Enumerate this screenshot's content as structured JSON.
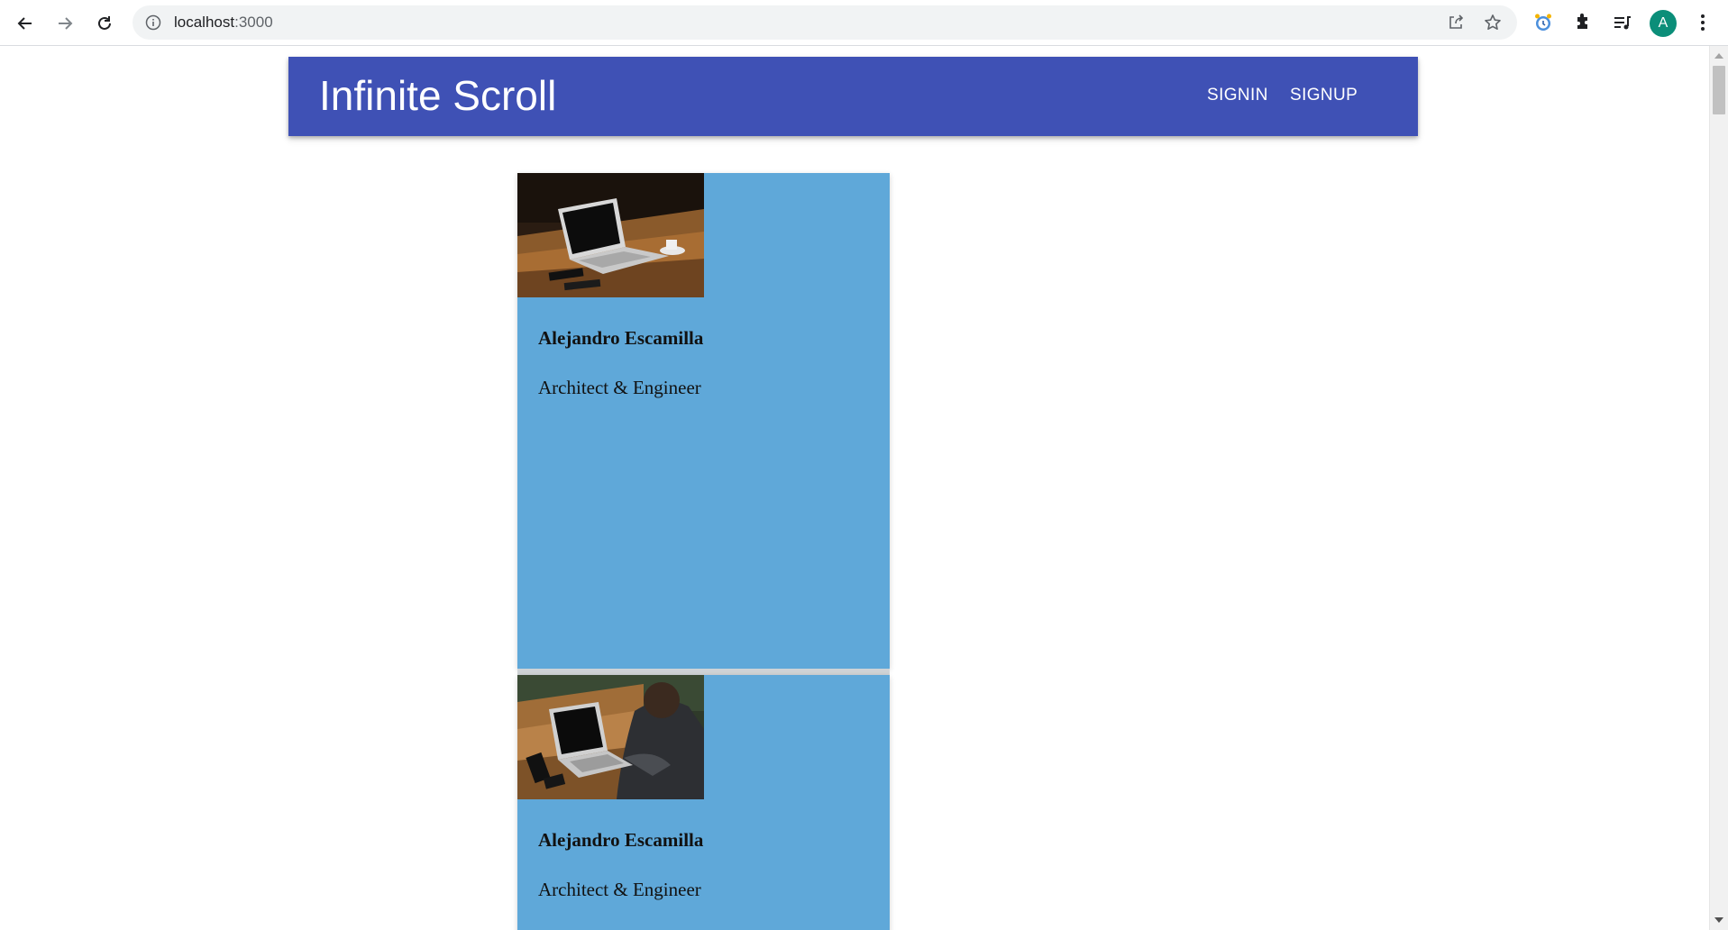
{
  "browser": {
    "url_host": "localhost",
    "url_port": ":3000",
    "profile_initial": "A",
    "colors": {
      "profile": "#0b8e79",
      "omnibox": "#f1f3f4"
    }
  },
  "app": {
    "title": "Infinite Scroll",
    "nav": {
      "signin": "SIGNIN",
      "signup": "SIGNUP"
    },
    "colors": {
      "appbar": "#3f51b5",
      "card": "#5fa8d9"
    }
  },
  "cards": [
    {
      "name": "Alejandro Escamilla",
      "role": "Architect & Engineer",
      "image": "laptop-on-table-photo"
    },
    {
      "name": "Alejandro Escamilla",
      "role": "Architect & Engineer",
      "image": "person-typing-laptop-photo"
    }
  ]
}
